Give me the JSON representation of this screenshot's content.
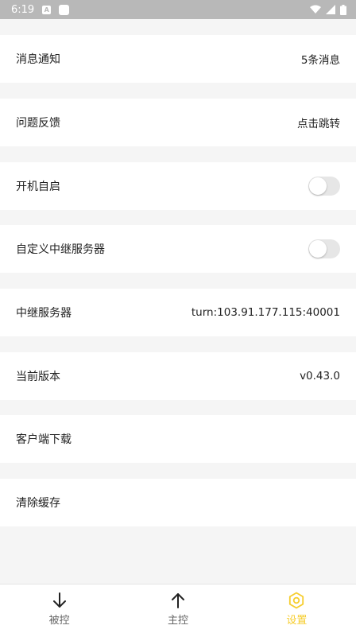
{
  "status_bar": {
    "time": "6:19",
    "notification_letter": "A"
  },
  "settings": [
    {
      "label": "消息通知",
      "value": "5条消息"
    },
    {
      "label": "问题反馈",
      "value": "点击跳转"
    },
    {
      "label": "开机自启",
      "toggle": false
    },
    {
      "label": "自定义中继服务器",
      "toggle": false
    },
    {
      "label": "中继服务器",
      "value": "turn:103.91.177.115:40001"
    },
    {
      "label": "当前版本",
      "value": "v0.43.0"
    },
    {
      "label": "客户端下载"
    },
    {
      "label": "清除缓存"
    }
  ],
  "bottom_nav": [
    {
      "label": "被控",
      "icon": "arrow-down-icon",
      "active": false
    },
    {
      "label": "主控",
      "icon": "arrow-up-icon",
      "active": false
    },
    {
      "label": "设置",
      "icon": "gear-icon",
      "active": true
    }
  ],
  "colors": {
    "accent": "#f6cd2d",
    "background": "#f5f5f5",
    "status_bar": "#b8b8b8"
  }
}
